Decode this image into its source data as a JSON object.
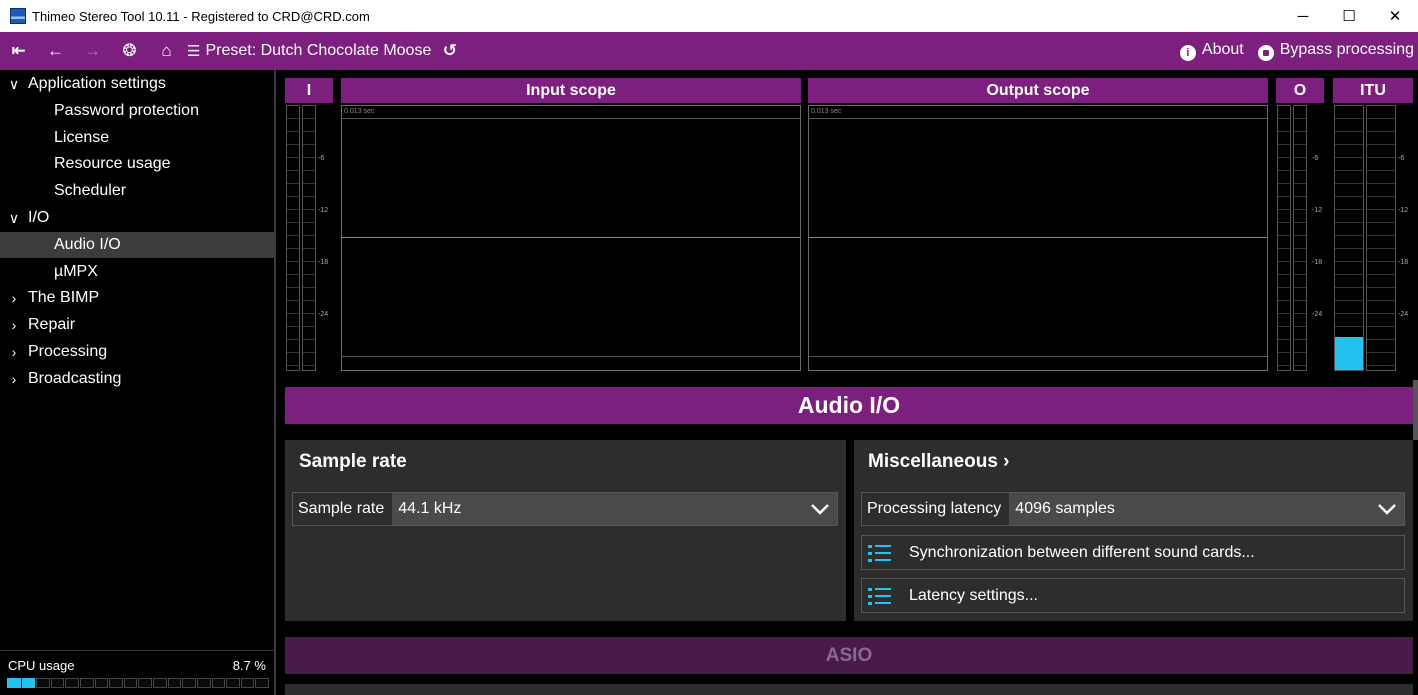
{
  "window": {
    "title": "Thimeo Stereo Tool 10.11 - Registered to CRD@CRD.com",
    "minimize": "─",
    "maximize": "☐",
    "close": "✕"
  },
  "toolbar": {
    "first_icon": "⇤",
    "back_icon": "←",
    "forward_icon": "→",
    "dashboard_icon": "❂",
    "home_icon": "⌂",
    "preset_icon": "☰",
    "preset_label": "Preset: Dutch Chocolate Moose",
    "reset_icon": "↺",
    "about_label": "About",
    "bypass_label": "Bypass processing"
  },
  "sidebar": {
    "items": [
      {
        "label": "Application settings",
        "chevron": "∨",
        "indent": false,
        "selected": false
      },
      {
        "label": "Password protection",
        "chevron": "",
        "indent": true,
        "selected": false
      },
      {
        "label": "License",
        "chevron": "",
        "indent": true,
        "selected": false
      },
      {
        "label": "Resource usage",
        "chevron": "",
        "indent": true,
        "selected": false
      },
      {
        "label": "Scheduler",
        "chevron": "",
        "indent": true,
        "selected": false
      },
      {
        "label": "I/O",
        "chevron": "∨",
        "indent": false,
        "selected": false
      },
      {
        "label": "Audio I/O",
        "chevron": "",
        "indent": true,
        "selected": true
      },
      {
        "label": "µMPX",
        "chevron": "",
        "indent": true,
        "selected": false
      },
      {
        "label": "The BIMP",
        "chevron": "›",
        "indent": false,
        "selected": false
      },
      {
        "label": "Repair",
        "chevron": "›",
        "indent": false,
        "selected": false
      },
      {
        "label": "Processing",
        "chevron": "›",
        "indent": false,
        "selected": false
      },
      {
        "label": "Broadcasting",
        "chevron": "›",
        "indent": false,
        "selected": false
      }
    ],
    "cpu_label": "CPU usage",
    "cpu_value": "8.7 %",
    "cpu_fraction": 0.087
  },
  "scopes": {
    "input_meter_label": "I",
    "input_scope_label": "Input scope",
    "output_scope_label": "Output scope",
    "output_meter_label": "O",
    "itu_meter_label": "ITU",
    "time_label": "0.013 sec",
    "scale": [
      "-6",
      "-12",
      "-18",
      "-24"
    ]
  },
  "section": {
    "title": "Audio I/O"
  },
  "sample_rate_panel": {
    "title": "Sample rate",
    "field_label": "Sample rate",
    "field_value": "44.1 kHz"
  },
  "misc_panel": {
    "title": "Miscellaneous  ›",
    "latency_label": "Processing latency",
    "latency_value": "4096 samples",
    "sync_button": "Synchronization between different sound cards...",
    "latency_settings_button": "Latency settings..."
  },
  "asio": {
    "title": "ASIO"
  },
  "colors": {
    "accent": "#7d1f7e",
    "meter": "#22c4ef",
    "panel": "#2d2d2d"
  }
}
